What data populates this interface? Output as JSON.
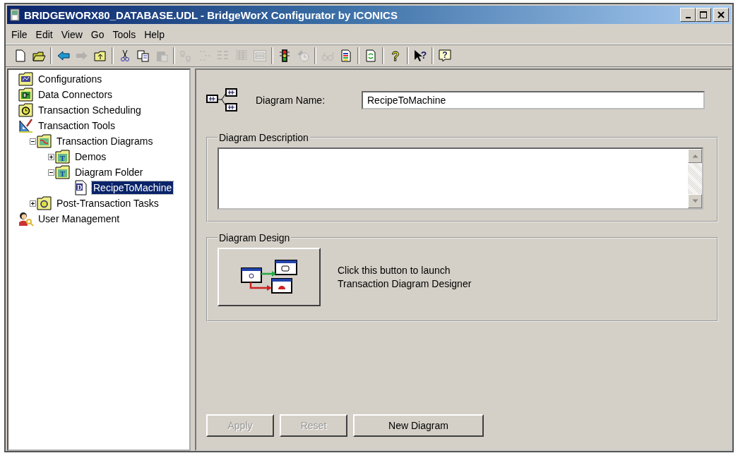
{
  "window": {
    "title": "BRIDGEWORX80_DATABASE.UDL - BridgeWorX Configurator by ICONICS"
  },
  "menu": [
    "File",
    "Edit",
    "View",
    "Go",
    "Tools",
    "Help"
  ],
  "toolbar": [
    {
      "kind": "new",
      "disabled": false
    },
    {
      "kind": "open",
      "disabled": false
    },
    {
      "kind": "separator"
    },
    {
      "kind": "back",
      "disabled": false
    },
    {
      "kind": "forward",
      "disabled": true
    },
    {
      "kind": "up",
      "disabled": false
    },
    {
      "kind": "separator"
    },
    {
      "kind": "cut",
      "disabled": false
    },
    {
      "kind": "copy",
      "disabled": false
    },
    {
      "kind": "paste",
      "disabled": true
    },
    {
      "kind": "separator"
    },
    {
      "kind": "large-icons",
      "disabled": true
    },
    {
      "kind": "small-icons",
      "disabled": true
    },
    {
      "kind": "list",
      "disabled": true
    },
    {
      "kind": "details",
      "disabled": true
    },
    {
      "kind": "form",
      "disabled": true
    },
    {
      "kind": "separator"
    },
    {
      "kind": "traffic-light",
      "disabled": false
    },
    {
      "kind": "schedule",
      "disabled": true
    },
    {
      "kind": "separator"
    },
    {
      "kind": "glasses",
      "disabled": true
    },
    {
      "kind": "report",
      "disabled": false
    },
    {
      "kind": "separator"
    },
    {
      "kind": "refresh",
      "disabled": false
    },
    {
      "kind": "separator"
    },
    {
      "kind": "help",
      "disabled": false,
      "glyph": "?"
    },
    {
      "kind": "separator"
    },
    {
      "kind": "pointer-help",
      "disabled": false,
      "glyph": "?"
    },
    {
      "kind": "separator"
    },
    {
      "kind": "help-balloon",
      "disabled": false,
      "glyph": "?"
    }
  ],
  "tree": [
    {
      "label": "Configurations",
      "kind": "config",
      "selected": false
    },
    {
      "label": "Data Connectors",
      "kind": "connector",
      "selected": false
    },
    {
      "label": "Transaction Scheduling",
      "kind": "schedule",
      "selected": false
    },
    {
      "label": "Transaction Tools",
      "kind": "tools",
      "selected": false,
      "children": [
        {
          "label": "Transaction Diagrams",
          "kind": "diagrams",
          "selected": false,
          "expanded": true,
          "children": [
            {
              "label": "Demos",
              "kind": "folder",
              "glyph": "T",
              "selected": false,
              "expanded": false
            },
            {
              "label": "Diagram Folder",
              "kind": "folder",
              "glyph": "T",
              "selected": false,
              "expanded": true,
              "children": [
                {
                  "label": "RecipeToMachine",
                  "kind": "diagram",
                  "glyph": "D",
                  "selected": true
                }
              ]
            }
          ]
        },
        {
          "label": "Post-Transaction Tasks",
          "kind": "tasks",
          "selected": false,
          "expanded": false
        }
      ]
    },
    {
      "label": "User Management",
      "kind": "users",
      "selected": false
    }
  ],
  "form": {
    "name_label": "Diagram Name:",
    "name_value": "RecipeToMachine",
    "description_group": "Diagram Description",
    "design_group": "Diagram Design",
    "design_hint": "Click this button to launch Transaction Diagram Designer"
  },
  "buttons": [
    {
      "label": "Apply",
      "disabled": true
    },
    {
      "label": "Reset",
      "disabled": true
    },
    {
      "label": "New Diagram",
      "disabled": false
    }
  ]
}
